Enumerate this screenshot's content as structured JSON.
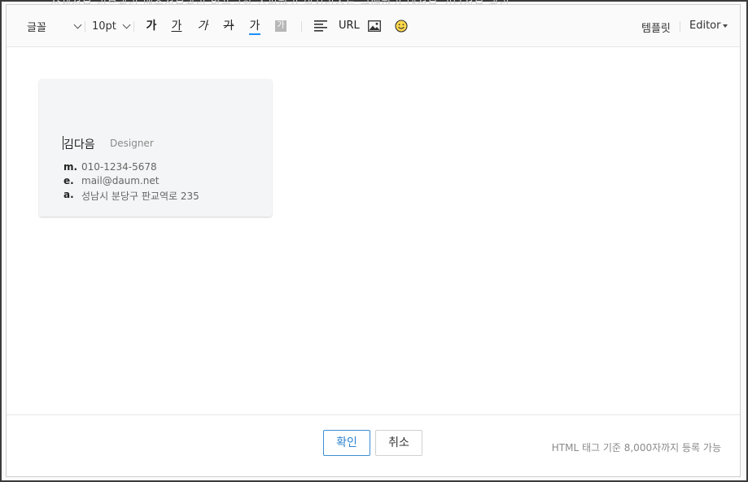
{
  "background_menu": "상세정보    리뷰관리    배송정보관리    반품교환    쇼핑하기    위시리스트    구매하기    내정보    기타정보    관리",
  "toolbar": {
    "font_label": "글꼴",
    "size_label": "10pt",
    "bold": "가",
    "underline": "가",
    "italic": "가",
    "strike": "가",
    "text_color": "가",
    "bg_color": "가",
    "url_label": "URL",
    "template_label": "템플릿",
    "editor_label": "Editor",
    "text_color_value": "#1e90ff"
  },
  "card": {
    "name": "김다음",
    "role": "Designer",
    "rows": [
      {
        "key": "m.",
        "value": "010-1234-5678"
      },
      {
        "key": "e.",
        "value": "mail@daum.net"
      },
      {
        "key": "a.",
        "value": "성남시 분당구 판교역로 235"
      }
    ]
  },
  "footer": {
    "confirm_label": "확인",
    "cancel_label": "취소",
    "note": "HTML 태그 기준 8,000자까지 등록 가능"
  },
  "icons": {
    "align": "align-left-icon",
    "image": "image-icon",
    "emoji": "smiley-icon"
  }
}
